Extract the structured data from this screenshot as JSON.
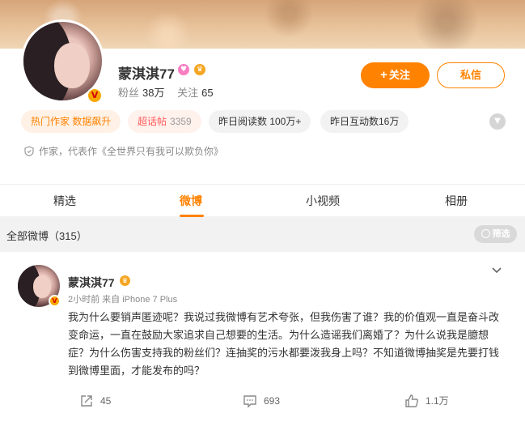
{
  "profile": {
    "name": "蒙淇淇77",
    "followers_label": "粉丝",
    "followers_value": "38万",
    "following_label": "关注",
    "following_value": "65",
    "follow_button": "关注",
    "message_button": "私信",
    "chips": [
      {
        "label": "热门作家 数据飙升"
      },
      {
        "label": "超话帖",
        "value": "3359"
      },
      {
        "label": "昨日阅读数 100万+"
      },
      {
        "label": "昨日互动数16万"
      }
    ],
    "intro": "作家，代表作《全世界只有我可以欺负你》"
  },
  "tabs": [
    "精选",
    "微博",
    "小视频",
    "相册"
  ],
  "active_tab": "微博",
  "filter": {
    "label": "全部微博（315）",
    "button": "筛选"
  },
  "post": {
    "author": "蒙淇淇77",
    "meta": "2小时前  来自 iPhone 7 Plus",
    "text": "我为什么要销声匿迹呢？我说过我微博有艺术夸张，但我伤害了谁？我的价值观一直是奋斗改变命运，一直在鼓励大家追求自己想要的生活。为什么造谣我们离婚了？为什么说我是臆想症？为什么伤害支持我的粉丝们？连抽奖的污水都要泼我身上吗？不知道微博抽奖是先要打钱到微博里面，才能发布的吗？",
    "repost_count": "45",
    "comment_count": "693",
    "like_count": "1.1万"
  },
  "colors": {
    "accent": "#ff8200",
    "background": "#f2f2f2"
  }
}
